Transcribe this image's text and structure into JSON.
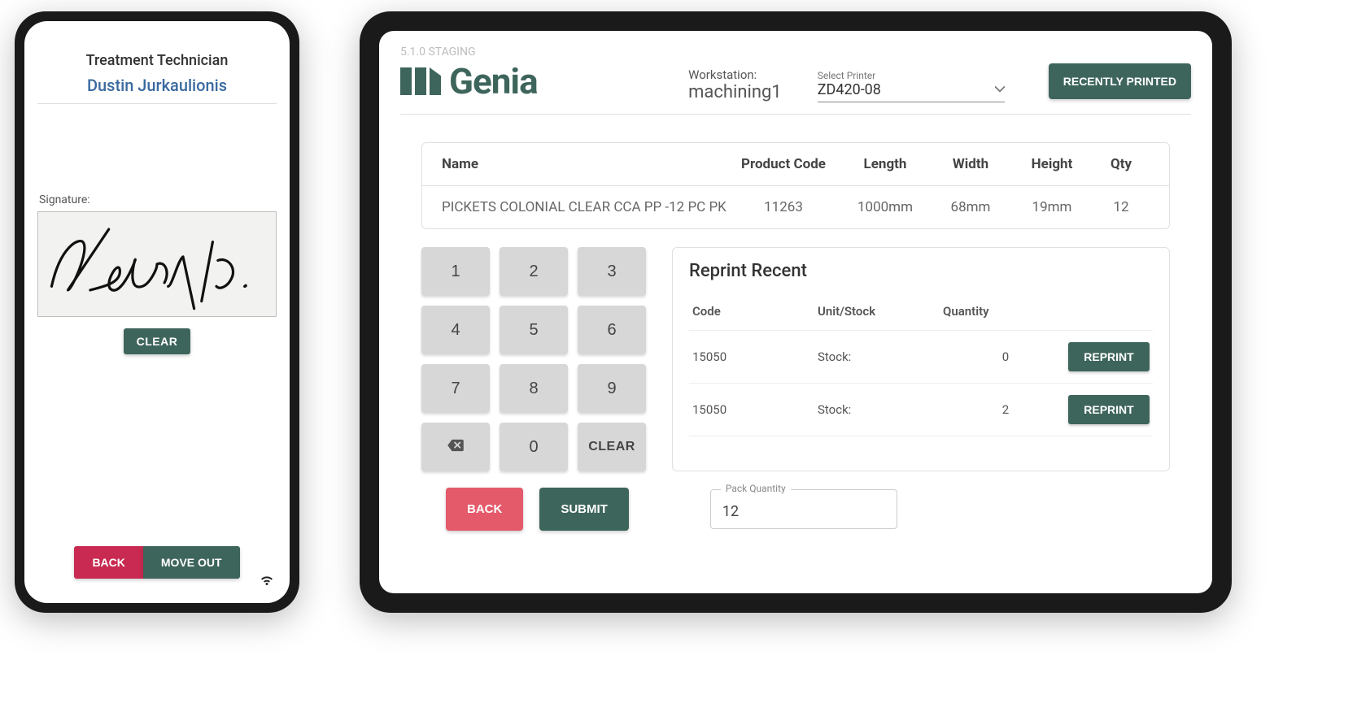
{
  "phone": {
    "title": "Treatment Technician",
    "name": "Dustin Jurkaulionis",
    "signature_label": "Signature:",
    "clear": "CLEAR",
    "back": "BACK",
    "move_out": "MOVE OUT"
  },
  "tablet": {
    "version": "5.1.0 STAGING",
    "brand": "Genia",
    "workstation_label": "Workstation:",
    "workstation_value": "machining1",
    "printer_label": "Select Printer",
    "printer_value": "ZD420-08",
    "recently_printed": "RECENTLY PRINTED",
    "table": {
      "headers": {
        "name": "Name",
        "code": "Product Code",
        "length": "Length",
        "width": "Width",
        "height": "Height",
        "qty": "Qty"
      },
      "row": {
        "name": "PICKETS COLONIAL CLEAR CCA PP -12 PC PK",
        "code": "11263",
        "length": "1000mm",
        "width": "68mm",
        "height": "19mm",
        "qty": "12"
      }
    },
    "keypad": {
      "k1": "1",
      "k2": "2",
      "k3": "3",
      "k4": "4",
      "k5": "5",
      "k6": "6",
      "k7": "7",
      "k8": "8",
      "k9": "9",
      "k0": "0",
      "clear": "CLEAR"
    },
    "reprint": {
      "title": "Reprint Recent",
      "headers": {
        "code": "Code",
        "unit": "Unit/Stock",
        "qty": "Quantity"
      },
      "rows": [
        {
          "code": "15050",
          "unit": "Stock:",
          "qty": "0"
        },
        {
          "code": "15050",
          "unit": "Stock:",
          "qty": "2"
        }
      ],
      "button": "REPRINT"
    },
    "back": "BACK",
    "submit": "SUBMIT",
    "pack_label": "Pack Quantity",
    "pack_value": "12"
  }
}
